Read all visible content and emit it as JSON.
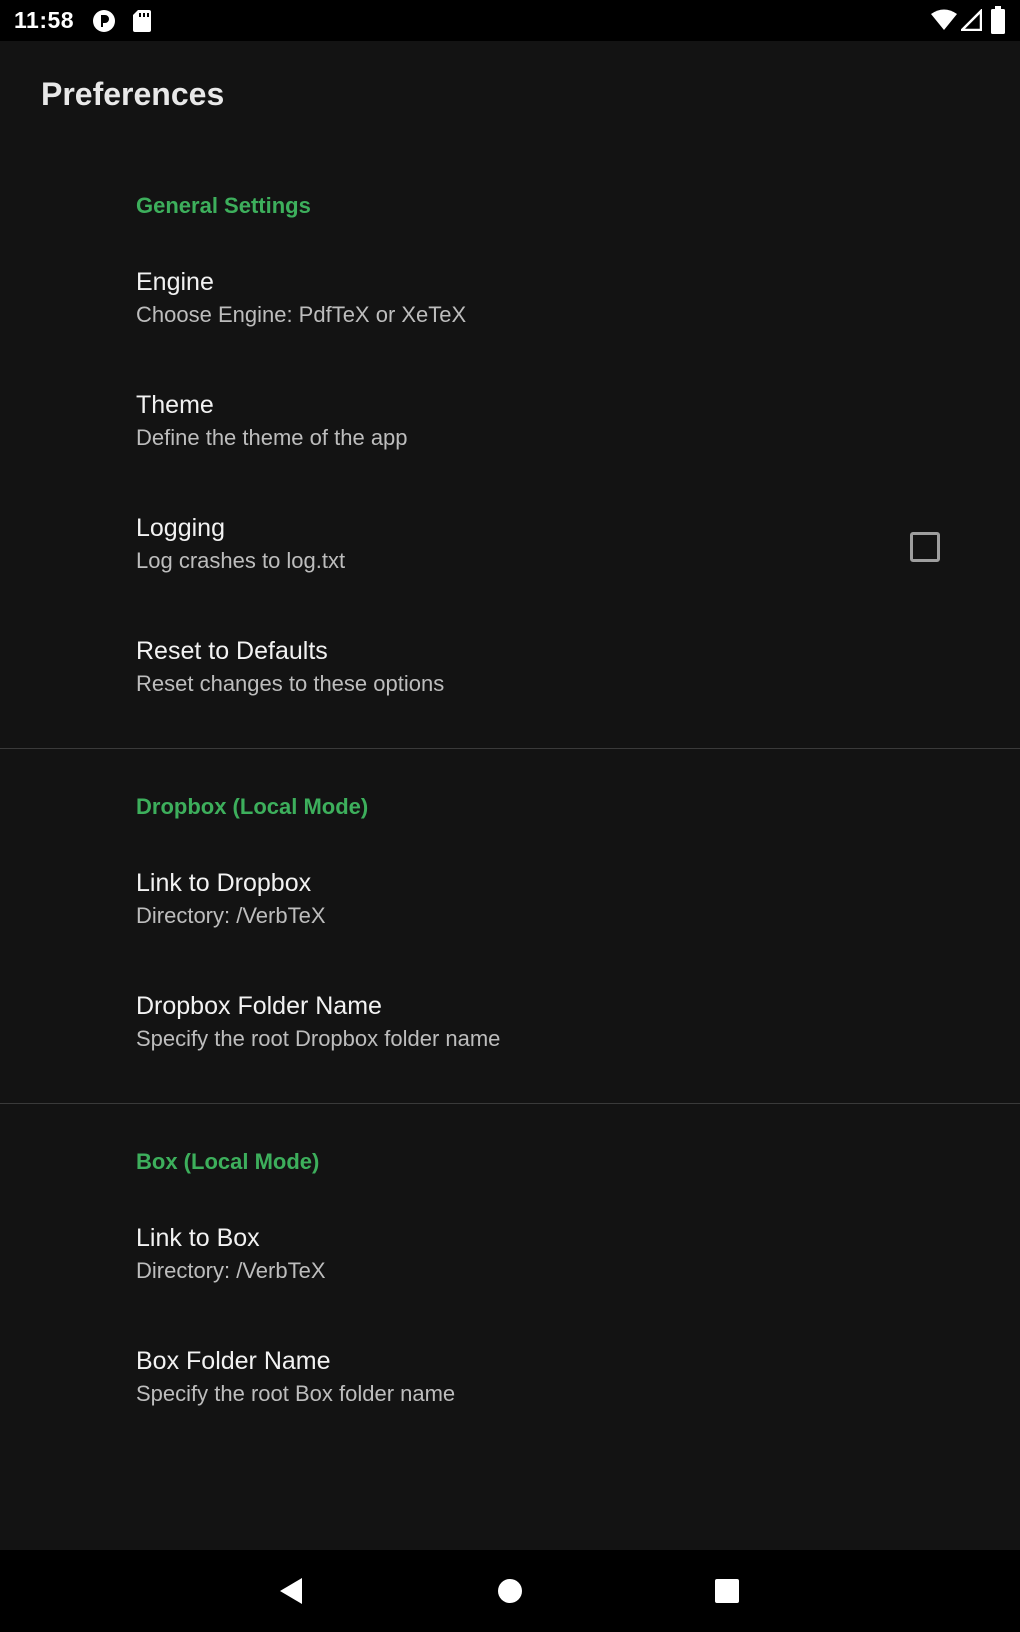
{
  "status_bar": {
    "time": "11:58",
    "icons": [
      "app-notification-icon",
      "sd-card-icon",
      "wifi-icon",
      "cell-signal-icon",
      "battery-icon"
    ]
  },
  "app_bar": {
    "title": "Preferences"
  },
  "sections": {
    "general": {
      "header": "General Settings",
      "engine": {
        "title": "Engine",
        "summary": "Choose Engine: PdfTeX or XeTeX"
      },
      "theme": {
        "title": "Theme",
        "summary": "Define the theme of the app"
      },
      "logging": {
        "title": "Logging",
        "summary": "Log crashes to log.txt",
        "checked": false
      },
      "reset": {
        "title": "Reset to Defaults",
        "summary": "Reset changes to these options"
      }
    },
    "dropbox": {
      "header": "Dropbox (Local Mode)",
      "link": {
        "title": "Link to Dropbox",
        "summary": "Directory: /VerbTeX"
      },
      "folder": {
        "title": "Dropbox Folder Name",
        "summary": "Specify the root Dropbox folder name"
      }
    },
    "box": {
      "header": "Box (Local Mode)",
      "link": {
        "title": "Link to Box",
        "summary": "Directory: /VerbTeX"
      },
      "folder": {
        "title": "Box Folder Name",
        "summary": "Specify the root Box folder name"
      }
    }
  },
  "nav_bar": {
    "buttons": [
      "back-icon",
      "home-icon",
      "recents-icon"
    ]
  },
  "colors": {
    "background": "#131313",
    "accent": "#3daf5c",
    "title_text": "#f2f2f2",
    "summary_text": "#bdbdbd",
    "divider": "#3a3a3a"
  }
}
